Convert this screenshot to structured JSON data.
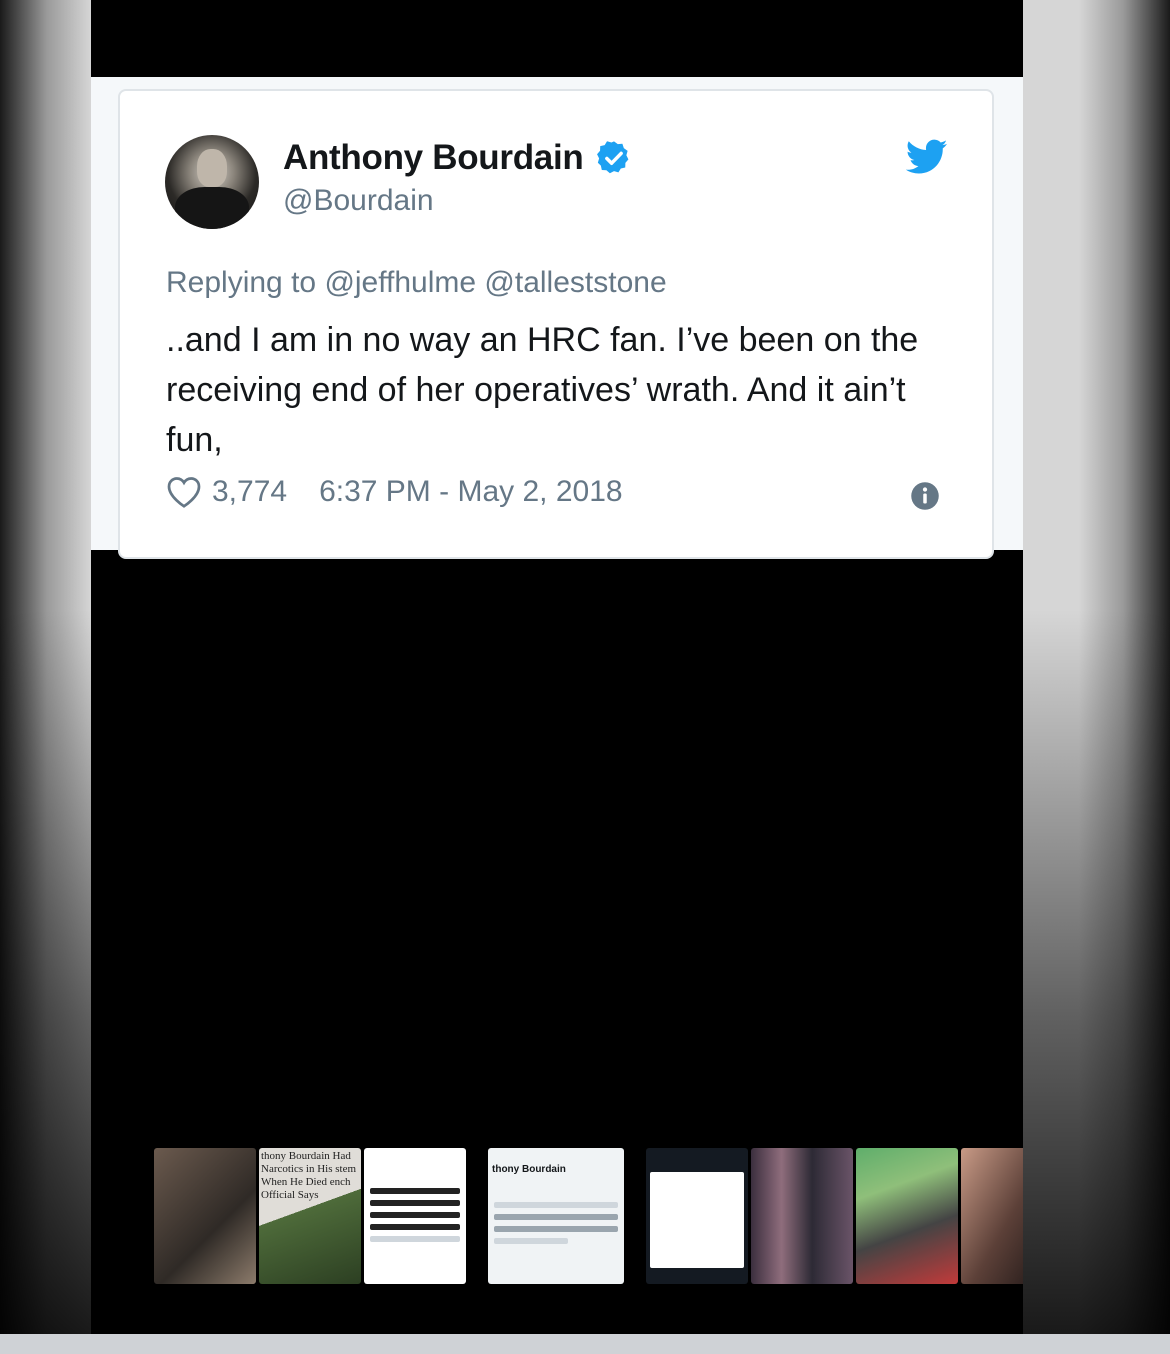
{
  "tweet": {
    "display_name": "Anthony Bourdain",
    "handle": "@Bourdain",
    "replying_prefix": "Replying to",
    "reply_mentions": "@jeffhulme @talleststone",
    "text": "..and I am in no way an HRC fan. I’ve been on the receiving end of her operatives’ wrath. And it ain’t fun,",
    "likes": "3,774",
    "timestamp": "6:37 PM - May 2, 2018"
  },
  "colors": {
    "verified_blue": "#1da1f2",
    "secondary_text": "#657786",
    "primary_text": "#14171a"
  },
  "icons": [
    "verified-badge-icon",
    "twitter-bird-icon",
    "heart-icon",
    "info-icon"
  ],
  "filmstrip": {
    "items": [
      {
        "kind": "photo"
      },
      {
        "kind": "article",
        "text": "thony Bourdain Had Narcotics in His stem When He Died ench Official Says"
      },
      {
        "kind": "tweet-screenshot"
      },
      {
        "kind": "tweet-card",
        "text": "thony Bourdain"
      },
      {
        "kind": "dark-screenshot"
      },
      {
        "kind": "collage"
      },
      {
        "kind": "photo"
      },
      {
        "kind": "photo"
      }
    ]
  }
}
